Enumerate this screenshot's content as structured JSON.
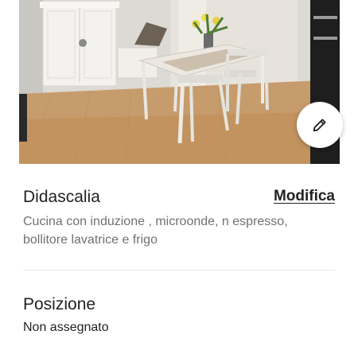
{
  "photo": {
    "subject": "kitchen-dining-room-photo"
  },
  "edit_button": {
    "icon": "pencil-icon"
  },
  "caption": {
    "title": "Didascalia",
    "edit_label": "Modifica",
    "text": "Cucina con induzione , microonde, n espresso, bollitore lavatrice e frigo"
  },
  "position": {
    "title": "Posizione",
    "value": "Non assegnato"
  }
}
